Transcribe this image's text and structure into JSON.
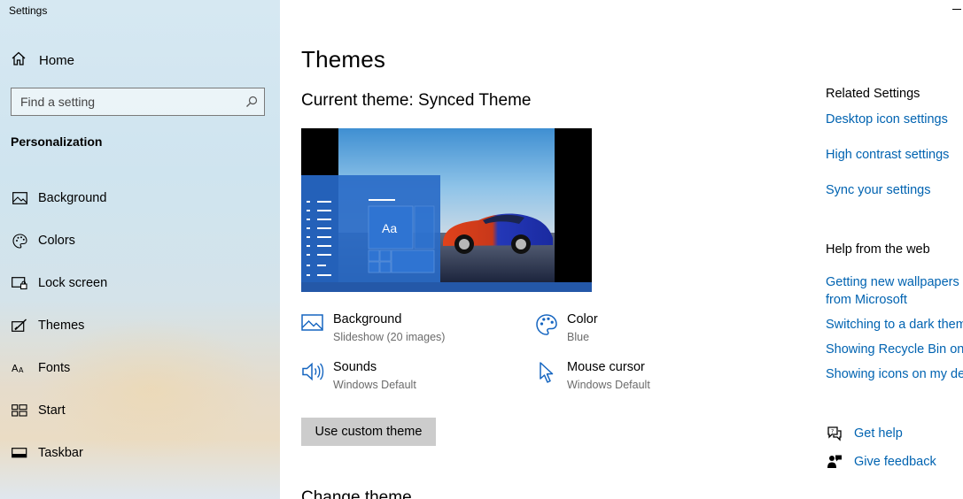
{
  "window": {
    "title": "Settings"
  },
  "sidebar": {
    "home_label": "Home",
    "search_placeholder": "Find a setting",
    "section_title": "Personalization",
    "items": [
      {
        "label": "Background",
        "icon": "image-icon"
      },
      {
        "label": "Colors",
        "icon": "palette-icon"
      },
      {
        "label": "Lock screen",
        "icon": "lock-screen-icon"
      },
      {
        "label": "Themes",
        "icon": "themes-icon"
      },
      {
        "label": "Fonts",
        "icon": "fonts-icon"
      },
      {
        "label": "Start",
        "icon": "start-icon"
      },
      {
        "label": "Taskbar",
        "icon": "taskbar-icon"
      }
    ]
  },
  "main": {
    "title": "Themes",
    "current_theme_label": "Current theme:",
    "current_theme_name": "Synced Theme",
    "preview_tile_text": "Aa",
    "props": {
      "background": {
        "label": "Background",
        "value": "Slideshow (20 images)"
      },
      "color": {
        "label": "Color",
        "value": "Blue"
      },
      "sounds": {
        "label": "Sounds",
        "value": "Windows Default"
      },
      "cursor": {
        "label": "Mouse cursor",
        "value": "Windows Default"
      }
    },
    "custom_button": "Use custom theme",
    "change_theme_title": "Change theme"
  },
  "related": {
    "title": "Related Settings",
    "links": [
      "Desktop icon settings",
      "High contrast settings",
      "Sync your settings"
    ]
  },
  "help_web": {
    "title": "Help from the web",
    "link1_line1": "Getting new wallpapers",
    "link1_line2": "from Microsoft",
    "link2": "Switching to a dark theme",
    "link3": "Showing Recycle Bin on desktop",
    "link4": "Showing icons on my desktop"
  },
  "help": {
    "get_help": "Get help",
    "give_feedback": "Give feedback"
  },
  "colors": {
    "accent": "#2a6bc7",
    "link": "#0063b1",
    "icon_blue": "#1565c0"
  }
}
